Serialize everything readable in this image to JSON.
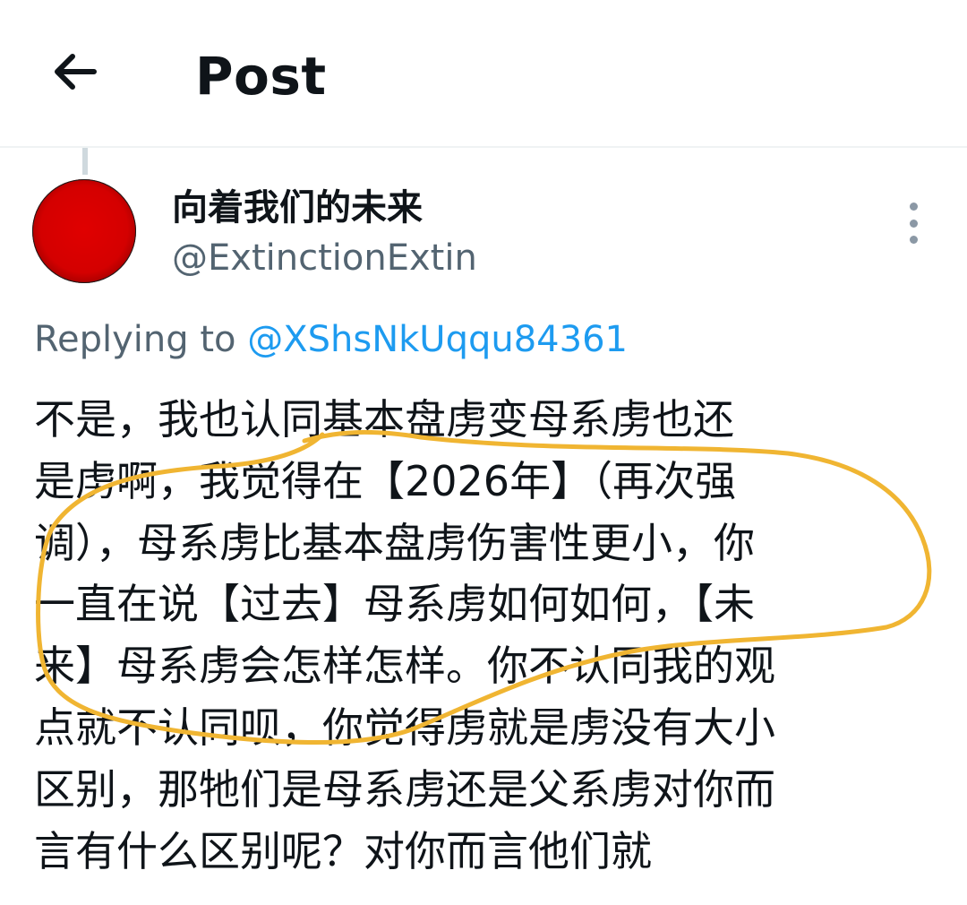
{
  "header": {
    "back_icon": "arrow-left-icon",
    "title": "Post"
  },
  "author": {
    "display_name": "向着我们的未来",
    "handle": "@ExtinctionExtin",
    "avatar_color": "#d40000",
    "more_icon": "more-vertical-icon"
  },
  "reply": {
    "prefix": "Replying to ",
    "mention": "@XShsNkUqqu84361"
  },
  "tweet": {
    "lines": [
      "不是，我也认同基本盘虏变母系虏也还",
      "是虏啊，我觉得在【2026年】（再次强",
      "调），母系虏比基本盘虏伤害性更小，你",
      "一直在说【过去】母系虏如何如何，【未",
      "来】母系虏会怎样怎样。你不认同我的观",
      "点就不认同呗，你觉得虏就是虏没有大小",
      "区别，那牠们是母系虏还是父系虏对你而",
      "言有什么区别呢？对你而言他们就"
    ]
  },
  "colors": {
    "text_primary": "#0f1419",
    "text_secondary": "#536471",
    "link": "#1d9bf0",
    "annotation": "#f0b532"
  }
}
